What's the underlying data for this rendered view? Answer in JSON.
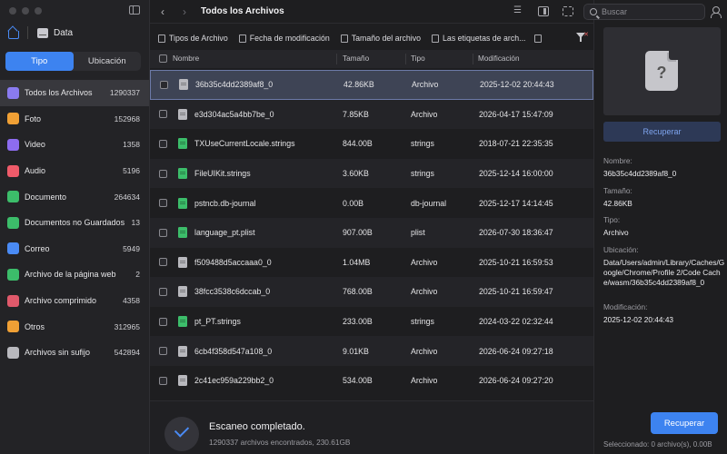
{
  "sidebar": {
    "crumb_label": "Data",
    "segments": {
      "tipo": "Tipo",
      "ubicacion": "Ubicación"
    },
    "categories": [
      {
        "label": "Todos los Archivos",
        "count": "1290337",
        "icon": "grid-icon",
        "color": "#8a7bf0"
      },
      {
        "label": "Foto",
        "count": "152968",
        "icon": "photo-icon",
        "color": "#f0a035"
      },
      {
        "label": "Video",
        "count": "1358",
        "icon": "video-icon",
        "color": "#8d6cf0"
      },
      {
        "label": "Audio",
        "count": "5196",
        "icon": "audio-icon",
        "color": "#ef5b6a"
      },
      {
        "label": "Documento",
        "count": "264634",
        "icon": "document-icon",
        "color": "#3cbd6a"
      },
      {
        "label": "Documentos no Guardados",
        "count": "13",
        "icon": "unsaved-document-icon",
        "color": "#3cbd6a"
      },
      {
        "label": "Correo",
        "count": "5949",
        "icon": "mail-icon",
        "color": "#4a8bf5"
      },
      {
        "label": "Archivo de la página web",
        "count": "2",
        "icon": "webpage-icon",
        "color": "#3cbd6a"
      },
      {
        "label": "Archivo comprimido",
        "count": "4358",
        "icon": "archive-icon",
        "color": "#e0596b"
      },
      {
        "label": "Otros",
        "count": "312965",
        "icon": "star-icon",
        "color": "#f0a035"
      },
      {
        "label": "Archivos sin sufijo",
        "count": "542894",
        "icon": "blank-file-icon",
        "color": "#b9b9be"
      }
    ]
  },
  "main": {
    "title": "Todos los Archivos",
    "filters": [
      "Tipos de Archivo",
      "Fecha de modificación",
      "Tamaño del archivo",
      "Las etiquetas de arch..."
    ],
    "columns": {
      "name": "Nombre",
      "size": "Tamaño",
      "type": "Tipo",
      "modified": "Modificación"
    },
    "rows": [
      {
        "name": "36b35c4dd2389af8_0",
        "size": "42.86KB",
        "type": "Archivo",
        "modified": "2025-12-02 20:44:43",
        "icon": "gray"
      },
      {
        "name": "e3d304ac5a4bb7be_0",
        "size": "7.85KB",
        "type": "Archivo",
        "modified": "2026-04-17 15:47:09",
        "icon": "gray"
      },
      {
        "name": "TXUseCurrentLocale.strings",
        "size": "844.00B",
        "type": "strings",
        "modified": "2018-07-21 22:35:35",
        "icon": "green"
      },
      {
        "name": "FileUIKit.strings",
        "size": "3.60KB",
        "type": "strings",
        "modified": "2025-12-14 16:00:00",
        "icon": "green"
      },
      {
        "name": "pstncb.db-journal",
        "size": "0.00B",
        "type": "db-journal",
        "modified": "2025-12-17 14:14:45",
        "icon": "green"
      },
      {
        "name": "language_pt.plist",
        "size": "907.00B",
        "type": "plist",
        "modified": "2026-07-30 18:36:47",
        "icon": "green"
      },
      {
        "name": "f509488d5accaaa0_0",
        "size": "1.04MB",
        "type": "Archivo",
        "modified": "2025-10-21 16:59:53",
        "icon": "gray"
      },
      {
        "name": "38fcc3538c6dccab_0",
        "size": "768.00B",
        "type": "Archivo",
        "modified": "2025-10-21 16:59:47",
        "icon": "gray"
      },
      {
        "name": "pt_PT.strings",
        "size": "233.00B",
        "type": "strings",
        "modified": "2024-03-22 02:32:44",
        "icon": "green"
      },
      {
        "name": "6cb4f358d547a108_0",
        "size": "9.01KB",
        "type": "Archivo",
        "modified": "2026-06-24 09:27:18",
        "icon": "gray"
      },
      {
        "name": "2c41ec959a229bb2_0",
        "size": "534.00B",
        "type": "Archivo",
        "modified": "2026-06-24 09:27:20",
        "icon": "gray"
      }
    ],
    "footer": {
      "title": "Escaneo completado.",
      "subtitle": "1290337 archivos encontrados, 230.61GB"
    }
  },
  "right_panel": {
    "search_placeholder": "Buscar",
    "recover_small": "Recuperar",
    "meta": {
      "name_label": "Nombre:",
      "name_value": "36b35c4dd2389af8_0",
      "size_label": "Tamaño:",
      "size_value": "42.86KB",
      "type_label": "Tipo:",
      "type_value": "Archivo",
      "location_label": "Ubicación:",
      "location_value": "Data/Users/admin/Library/Caches/Google/Chrome/Profile 2/Code Cache/wasm/36b35c4dd2389af8_0",
      "modified_label": "Modificación:",
      "modified_value": "2025-12-02 20:44:43"
    },
    "recover_big": "Recuperar",
    "selected_info": "Seleccionado: 0 archivo(s), 0.00B"
  }
}
